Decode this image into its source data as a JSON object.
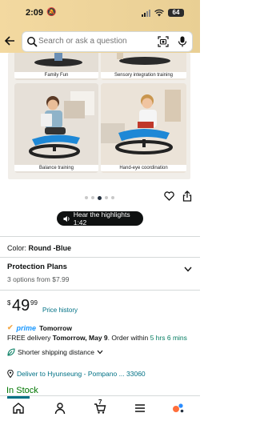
{
  "status_bar": {
    "time": "2:09",
    "battery": "64"
  },
  "search": {
    "placeholder": "Search or ask a question"
  },
  "gallery": {
    "labels": [
      "Family Fun",
      "Sensory integration training",
      "Balance training",
      "Hand-eye coordination"
    ]
  },
  "carousel": {
    "highlights_label": "Hear the highlights 1:42"
  },
  "color": {
    "label": "Color:",
    "value": "Round -Blue"
  },
  "protection": {
    "title": "Protection Plans",
    "options": "3 options from $7.99"
  },
  "price": {
    "symbol": "$",
    "whole": "49",
    "fraction": "99",
    "history_link": "Price history"
  },
  "delivery": {
    "prime_label": "prime",
    "prime_speed": "Tomorrow",
    "free_prefix": "FREE delivery",
    "date": "Tomorrow, May 9",
    "order_within": ". Order within",
    "countdown": "5 hrs 6 mins",
    "shorter_shipping": "Shorter shipping distance"
  },
  "location": {
    "text": "Deliver to Hyunseung - Pompano ... 33060"
  },
  "stock": {
    "text": "In Stock"
  },
  "nav": {
    "cart_count": "7"
  },
  "colors": {
    "accent_teal": "#007185",
    "stock_green": "#007600",
    "prime_blue": "#1a98ff"
  }
}
